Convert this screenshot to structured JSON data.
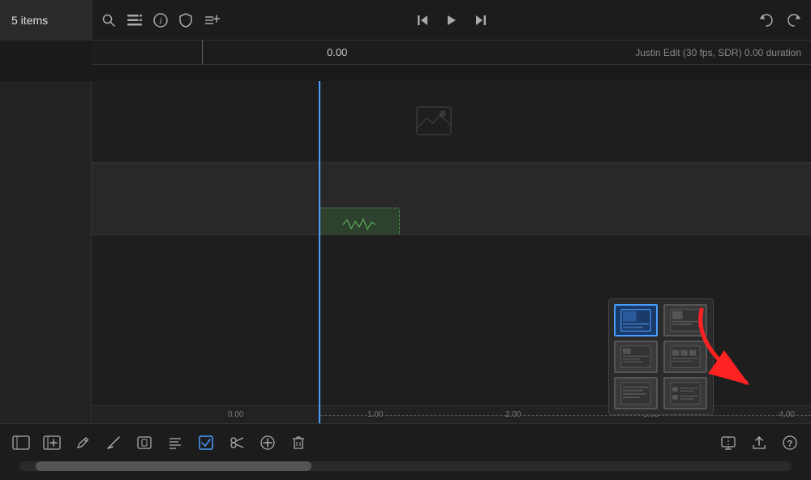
{
  "header": {
    "items_count": "5 items"
  },
  "toolbar": {
    "search_icon": "🔍",
    "list_icon": "☰",
    "info_icon": "ⓘ",
    "shield_icon": "🛡",
    "add_icon": "⊕",
    "rewind_icon": "⏮",
    "play_icon": "▶",
    "skip_icon": "⏭",
    "undo_icon": "↩",
    "redo_icon": "↪"
  },
  "timecode": {
    "current": "0.00",
    "edit_info": "Justin Edit (30 fps, SDR)  0.00 duration"
  },
  "ruler": {
    "marks": [
      "0.00",
      "1.00",
      "2.00",
      "3.00",
      "4.00"
    ]
  },
  "bottom_toolbar": {
    "icons": [
      {
        "name": "clip-icon",
        "symbol": "▭"
      },
      {
        "name": "add-clip-icon",
        "symbol": "⊞"
      },
      {
        "name": "trim-icon",
        "symbol": "✏"
      },
      {
        "name": "blade-icon",
        "symbol": "/"
      },
      {
        "name": "transform-icon",
        "symbol": "⊡"
      },
      {
        "name": "title-icon",
        "symbol": "≡"
      },
      {
        "name": "checkbox-icon",
        "symbol": "☑"
      },
      {
        "name": "cut-icon",
        "symbol": "✂"
      },
      {
        "name": "plus-icon",
        "symbol": "⊕"
      },
      {
        "name": "delete-icon",
        "symbol": "🗑"
      },
      {
        "name": "monitor-icon",
        "symbol": "⬚"
      },
      {
        "name": "export-icon",
        "symbol": "⬆"
      },
      {
        "name": "help-icon",
        "symbol": "?"
      }
    ]
  },
  "thumbnail_popup": {
    "items": [
      {
        "id": "thumb-1",
        "active": true,
        "label": "large-thumbnail"
      },
      {
        "id": "thumb-2",
        "active": false,
        "label": "medium-thumbnail"
      },
      {
        "id": "thumb-3",
        "active": false,
        "label": "small-thumbnail"
      },
      {
        "id": "thumb-4",
        "active": false,
        "label": "filmstrip-thumbnail"
      },
      {
        "id": "thumb-5",
        "active": false,
        "label": "text-only"
      },
      {
        "id": "thumb-6",
        "active": false,
        "label": "compact"
      }
    ]
  },
  "colors": {
    "background": "#1a1a1a",
    "panel_bg": "#222222",
    "toolbar_bg": "#1c1c1c",
    "accent_blue": "#4a9eff",
    "track_dark": "#1e1e1e",
    "track_light": "#282828"
  }
}
